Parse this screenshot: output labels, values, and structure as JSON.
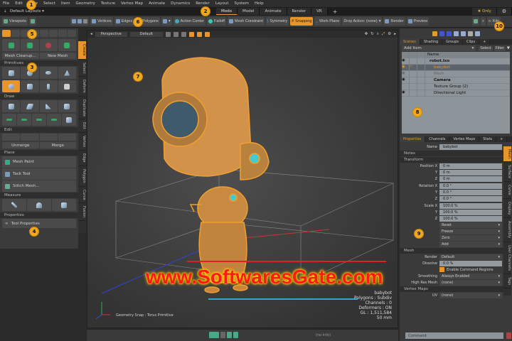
{
  "menu": [
    "File",
    "Edit",
    "View",
    "Select",
    "Item",
    "Geometry",
    "Texture",
    "Vertex Map",
    "Animate",
    "Dynamics",
    "Render",
    "Layout",
    "System",
    "Help"
  ],
  "layout": {
    "preset": "Default Layouts ▾",
    "tabs": [
      "Modo",
      "Model",
      "Animate",
      "Render",
      "VR",
      "+"
    ],
    "active_tab": "Modo",
    "only_label": "★ Only"
  },
  "toolbar": {
    "viewports": "Viewports",
    "vertices": "Vertices",
    "edges": "Edges",
    "polygons": "Polygons",
    "action_center": "Action Center",
    "falloff": "Falloff",
    "mesh_constraint": "Mesh Constraint",
    "symmetry": "Symmetry",
    "snapping": "Snapping",
    "work_plane": "Work Plane",
    "drop_action": "Drop Action: (none)",
    "render": "Render",
    "preview": "Preview",
    "kits": "Kits"
  },
  "left": {
    "mesh_cleanup": "Mesh Cleanup...",
    "new_mesh": "New Mesh",
    "sections": {
      "primitives": "Primitives",
      "draw": "Draw",
      "edit": "Edit",
      "place": "Place",
      "measure": "Measure",
      "properties": "Properties"
    },
    "unmerge": "Unmerge",
    "merge": "Merge",
    "place_tools": [
      "Mesh Paint",
      "Tack Tool",
      "Stitch Mesh..."
    ],
    "tool_properties": "Tool Properties",
    "vtabs": [
      "Create",
      "Select",
      "Deform",
      "Duplicate",
      "Edit",
      "Vertex",
      "Edge",
      "Polygon",
      "Curve",
      "Fusion"
    ]
  },
  "viewport": {
    "view": "Perspective",
    "style": "Default",
    "snap_status": "Geometry Snap : Torus Primitive",
    "hud": [
      "babybot",
      "Polygons : Subdiv",
      "Channels : 0",
      "Deformers : ON",
      "GL : 1,511,584",
      "50 mm"
    ],
    "watermark": "www.SoftwaresGate.com"
  },
  "bottom": {
    "info": "(no info)"
  },
  "scenes": {
    "tabs": [
      "Scenes",
      "Shading",
      "Groups",
      "Clips",
      "+"
    ],
    "add_item": "Add Item",
    "select": "Select",
    "filter": "Filter",
    "name_header": "Name",
    "items": [
      "robot.lxo",
      "babybot",
      "Mesh",
      "Camera",
      "Texture Group (2)",
      "Directional Light"
    ]
  },
  "properties": {
    "tabs": [
      "Properties",
      "Channels",
      "Vertex Maps",
      "Stats",
      "+"
    ],
    "name_label": "Name",
    "name_value": "babybot",
    "notes": "Notes",
    "transform": "Transform",
    "position": {
      "label": "Position X",
      "values": [
        "0 m",
        "0 m",
        "0 m"
      ]
    },
    "rotation": {
      "label": "Rotation X",
      "values": [
        "0.0 °",
        "0.0 °",
        "0.0 °"
      ]
    },
    "scale": {
      "label": "Scale X",
      "values": [
        "100.0 %",
        "100.0 %",
        "100.0 %"
      ]
    },
    "axis_y": "Y",
    "axis_z": "Z",
    "actions": [
      "Reset",
      "Freeze",
      "Zero",
      "Add"
    ],
    "mesh": "Mesh",
    "render_label": "Render",
    "render_value": "Default",
    "dissolve_label": "Dissolve",
    "dissolve_value": "0.0 %",
    "enable_cmd": "Enable Command Regions",
    "smoothing_label": "Smoothing",
    "smoothing_value": "Always Enabled",
    "highres_label": "High Res Mesh",
    "highres_value": "(none)",
    "vertex_maps": "Vertex Maps",
    "uv_label": "UV",
    "uv_value": "(none)",
    "vtabs": [
      "Mesh",
      "Surface",
      "Curve",
      "Display",
      "Assembly",
      "User Channels",
      "Tags"
    ]
  },
  "command": {
    "placeholder": "Command"
  },
  "badges": [
    "1",
    "2",
    "3",
    "4",
    "5",
    "6",
    "7",
    "8",
    "9",
    "10"
  ],
  "colors": {
    "accent": "#e8962a",
    "badge": "#f2a81d",
    "mesh": "#f0a030"
  }
}
